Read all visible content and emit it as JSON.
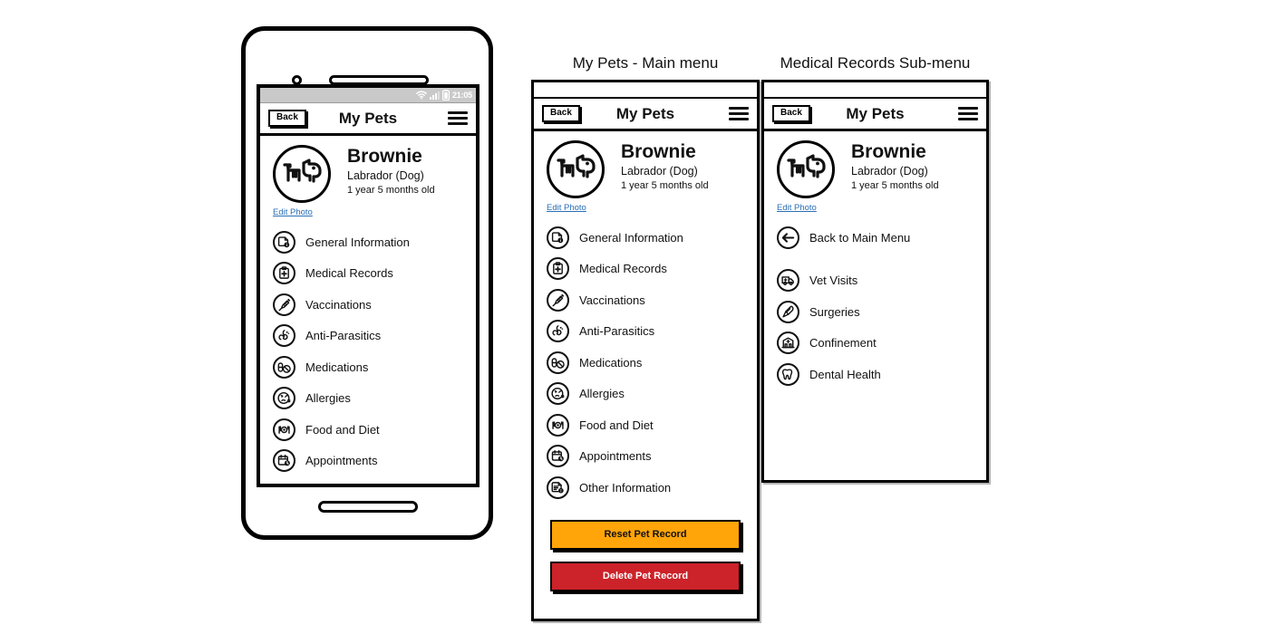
{
  "panels": {
    "phone_mockup": {
      "name": "phone-mockup",
      "statusbar": {
        "time": "21:05",
        "icons": [
          "wifi-icon",
          "signal-icon",
          "battery-icon"
        ]
      },
      "appbar": {
        "back_label": "Back",
        "title": "My Pets",
        "menu_icon": "hamburger-icon"
      },
      "pet": {
        "avatar_icon": "dog-icon",
        "edit_photo_label": "Edit Photo",
        "name": "Brownie",
        "breed": "Labrador (Dog)",
        "age": "1 year 5 months old"
      },
      "menu_items": [
        {
          "label": "General Information",
          "icon": "document-info-icon"
        },
        {
          "label": "Medical Records",
          "icon": "clipboard-medical-icon"
        },
        {
          "label": "Vaccinations",
          "icon": "syringe-icon"
        },
        {
          "label": "Anti-Parasitics",
          "icon": "parasite-icon"
        },
        {
          "label": "Medications",
          "icon": "pills-icon"
        },
        {
          "label": "Allergies",
          "icon": "sneezing-face-icon"
        },
        {
          "label": "Food and Diet",
          "icon": "food-plate-icon"
        },
        {
          "label": "Appointments",
          "icon": "calendar-clock-icon"
        }
      ]
    },
    "main_menu": {
      "caption": "My Pets - Main menu",
      "appbar": {
        "back_label": "Back",
        "title": "My Pets",
        "menu_icon": "hamburger-icon"
      },
      "pet": {
        "avatar_icon": "dog-icon",
        "edit_photo_label": "Edit Photo",
        "name": "Brownie",
        "breed": "Labrador (Dog)",
        "age": "1 year 5 months old"
      },
      "menu_items": [
        {
          "label": "General Information",
          "icon": "document-info-icon"
        },
        {
          "label": "Medical Records",
          "icon": "clipboard-medical-icon"
        },
        {
          "label": "Vaccinations",
          "icon": "syringe-icon"
        },
        {
          "label": "Anti-Parasitics",
          "icon": "parasite-icon"
        },
        {
          "label": "Medications",
          "icon": "pills-icon"
        },
        {
          "label": "Allergies",
          "icon": "sneezing-face-icon"
        },
        {
          "label": "Food and Diet",
          "icon": "food-plate-icon"
        },
        {
          "label": "Appointments",
          "icon": "calendar-clock-icon"
        },
        {
          "label": "Other Information",
          "icon": "document-list-icon"
        }
      ],
      "actions": {
        "reset_label": "Reset Pet Record",
        "delete_label": "Delete Pet Record",
        "reset_color": "#FFA50A",
        "delete_color": "#CC2229"
      }
    },
    "sub_menu": {
      "caption": "Medical Records Sub-menu",
      "appbar": {
        "back_label": "Back",
        "title": "My Pets",
        "menu_icon": "hamburger-icon"
      },
      "pet": {
        "avatar_icon": "dog-icon",
        "edit_photo_label": "Edit Photo",
        "name": "Brownie",
        "breed": "Labrador (Dog)",
        "age": "1 year 5 months old"
      },
      "back_item": {
        "label": "Back to Main Menu",
        "icon": "arrow-left-icon"
      },
      "menu_items": [
        {
          "label": "Vet Visits",
          "icon": "ambulance-icon"
        },
        {
          "label": "Surgeries",
          "icon": "scalpel-icon"
        },
        {
          "label": "Confinement",
          "icon": "hospital-icon"
        },
        {
          "label": "Dental Health",
          "icon": "tooth-icon"
        }
      ]
    }
  }
}
